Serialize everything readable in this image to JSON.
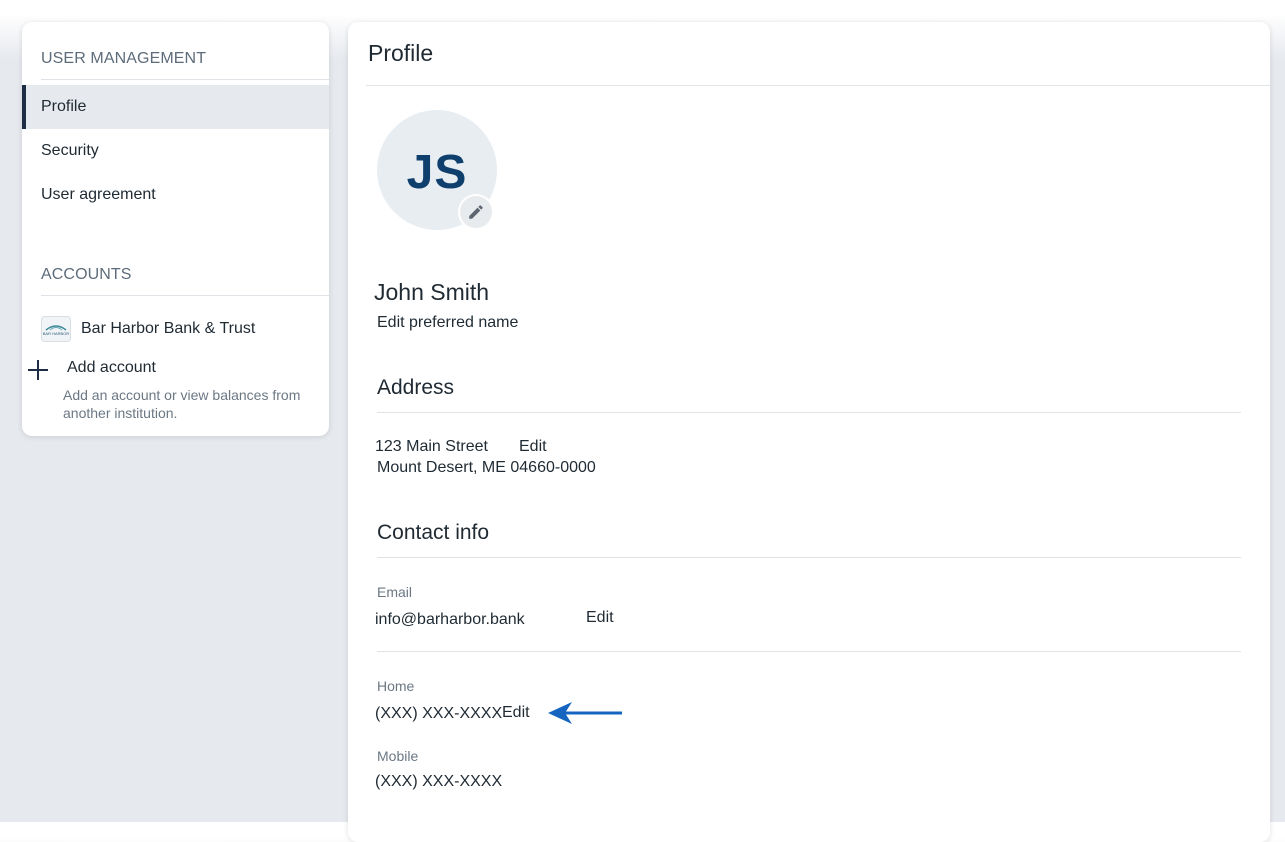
{
  "sidebar": {
    "user_management_heading": "USER MANAGEMENT",
    "items": [
      {
        "label": "Profile",
        "active": true
      },
      {
        "label": "Security",
        "active": false
      },
      {
        "label": "User agreement",
        "active": false
      }
    ],
    "accounts_heading": "ACCOUNTS",
    "account": {
      "name": "Bar Harbor Bank & Trust",
      "logo_text": "BAR HARBOR"
    },
    "add_account": {
      "title": "Add account",
      "description": "Add an account or view balances from another institution."
    }
  },
  "main": {
    "title": "Profile",
    "avatar": {
      "initials": "JS",
      "edit_icon": "pencil-icon"
    },
    "name": "John Smith",
    "edit_preferred_name": "Edit preferred name",
    "address": {
      "heading": "Address",
      "line1": "123 Main Street",
      "line2": "Mount Desert, ME 04660-0000",
      "edit": "Edit"
    },
    "contact": {
      "heading": "Contact info",
      "email_label": "Email",
      "email": "info@barharbor.bank",
      "email_edit": "Edit",
      "home_label": "Home",
      "home": "(XXX) XXX-XXXX",
      "home_edit": "Edit",
      "mobile_label": "Mobile",
      "mobile": "(XXX) XXX-XXXX"
    }
  },
  "colors": {
    "accent": "#1c2d44",
    "avatar_text": "#0f3f6c",
    "arrow": "#1565c0"
  }
}
